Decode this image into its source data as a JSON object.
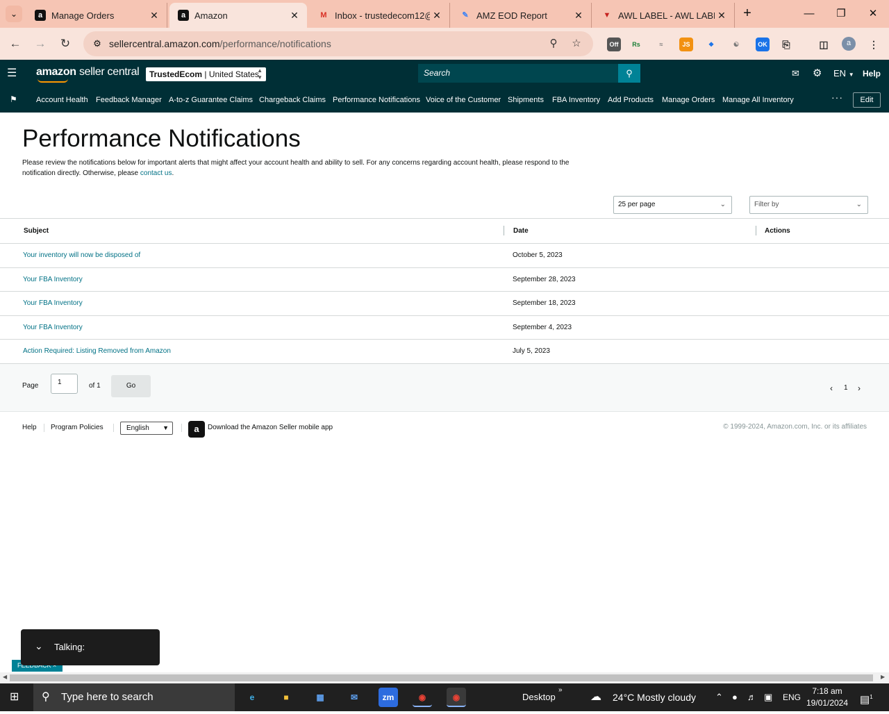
{
  "browser": {
    "tabs": [
      {
        "title": "Manage Orders",
        "favicon": "amazon-icon",
        "active": false
      },
      {
        "title": "Amazon",
        "favicon": "amazon-icon",
        "active": true
      },
      {
        "title": "Inbox - trustedecom12@",
        "favicon": "gmail-icon",
        "active": false
      },
      {
        "title": "AMZ EOD Report",
        "favicon": "sheets-icon",
        "active": false
      },
      {
        "title": "AWL LABEL - AWL LABEL",
        "favicon": "label-icon",
        "active": false
      }
    ],
    "url_host": "sellercentral.amazon.com",
    "url_path": "/performance/notifications",
    "profile_initial": "a",
    "extension_badge": "OK",
    "extension_off": "Off"
  },
  "header": {
    "logo_bold": "amazon",
    "logo_light": "seller central",
    "account_store": "TrustedEcom",
    "account_region": "United States",
    "search_placeholder": "Search",
    "language": "EN",
    "help": "Help"
  },
  "nav": {
    "items": [
      "Account Health",
      "Feedback Manager",
      "A-to-z Guarantee Claims",
      "Chargeback Claims",
      "Performance Notifications",
      "Voice of the Customer",
      "Shipments",
      "FBA Inventory",
      "Add Products",
      "Manage Orders",
      "Manage All Inventory"
    ],
    "more": "···",
    "edit": "Edit"
  },
  "page": {
    "title": "Performance Notifications",
    "intro": "Please review the notifications below for important alerts that might affect your account health and ability to sell. For any concerns regarding account health, please respond to the notification directly. Otherwise, please",
    "intro_link": "contact us",
    "intro_end": ".",
    "per_page": "25 per page",
    "filter": "Filter by"
  },
  "table": {
    "headers": {
      "subject": "Subject",
      "date": "Date",
      "actions": "Actions"
    },
    "rows": [
      {
        "subject": "Your inventory will now be disposed of",
        "date": "October 5, 2023"
      },
      {
        "subject": "Your FBA Inventory",
        "date": "September 28, 2023"
      },
      {
        "subject": "Your FBA Inventory",
        "date": "September 18, 2023"
      },
      {
        "subject": "Your FBA Inventory",
        "date": "September 4, 2023"
      },
      {
        "subject": "Action Required: Listing Removed from Amazon",
        "date": "July 5, 2023"
      }
    ]
  },
  "pager": {
    "page_label": "Page",
    "page_value": "1",
    "of_label": "of 1",
    "go": "Go",
    "current": "1"
  },
  "footer": {
    "help": "Help",
    "policies": "Program Policies",
    "language": "English",
    "app": "Download the Amazon Seller mobile app",
    "copyright": "© 1999-2024, Amazon.com, Inc. or its affiliates"
  },
  "overlay": {
    "talking": "Talking:",
    "feedback": "FEEDBACK"
  },
  "taskbar": {
    "search_placeholder": "Type here to search",
    "desktop": "Desktop",
    "weather": "24°C  Mostly cloudy",
    "lang": "ENG",
    "time": "7:18 am",
    "date": "19/01/2024",
    "notif_count": "1"
  }
}
